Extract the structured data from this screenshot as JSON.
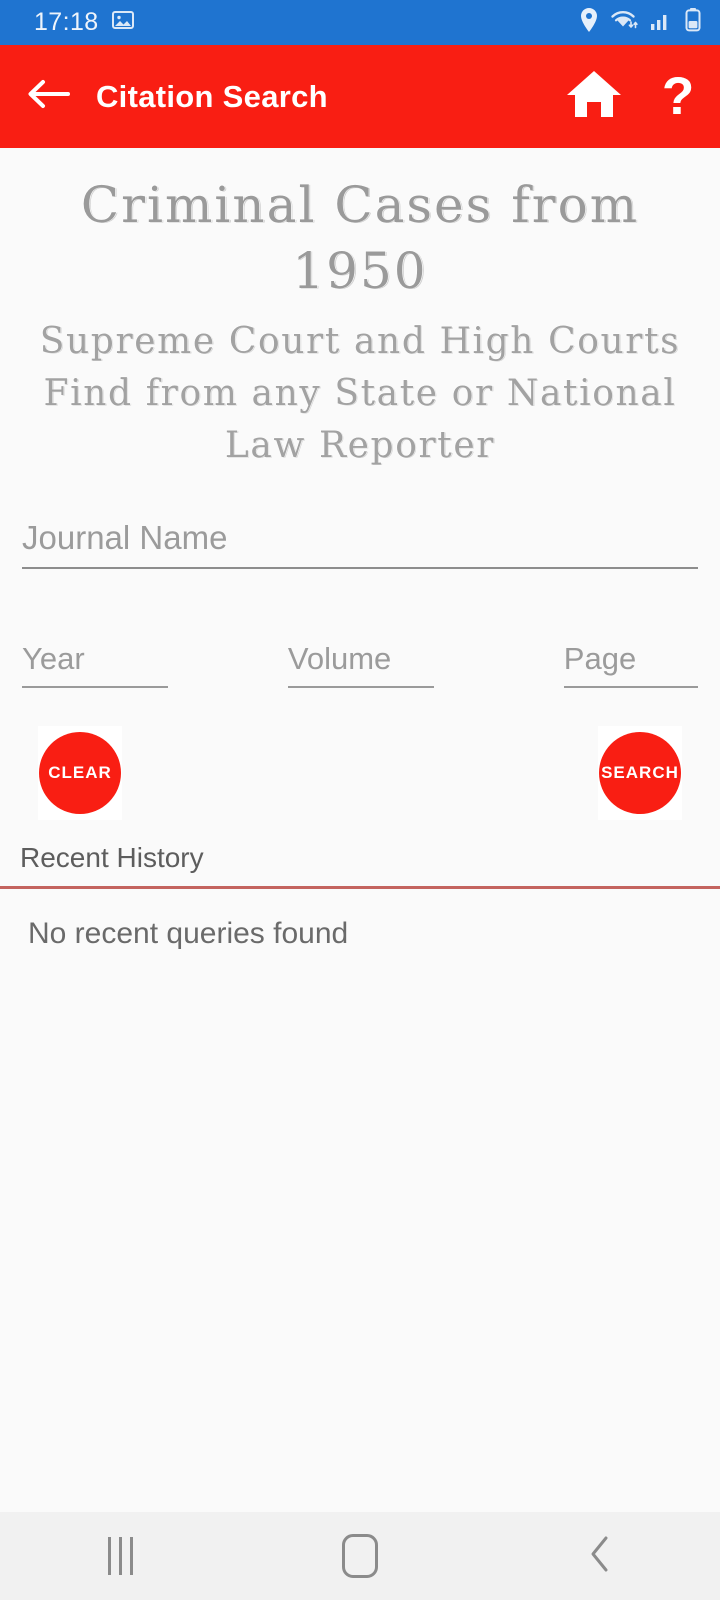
{
  "status_bar": {
    "time": "17:18",
    "icons": [
      "image-icon",
      "location-icon",
      "wifi-icon",
      "cellular-signal-icon",
      "battery-icon"
    ],
    "background_color": "#1f74d0",
    "text_color": "#eef4fb"
  },
  "app_bar": {
    "back_label": "back-arrow",
    "title": "Citation Search",
    "home_label": "home-icon",
    "help_label": "?",
    "background_color": "#f91e13",
    "text_color": "#ffffff"
  },
  "headline": {
    "line1": "Criminal Cases from",
    "line2": "1950",
    "sub1": "Supreme Court and High Courts",
    "sub2": "Find from any State or National",
    "sub3": "Law Reporter",
    "color": "#9a9a9a"
  },
  "form": {
    "journal": {
      "label": "Journal Name",
      "placeholder": "Journal Name",
      "value": ""
    },
    "year": {
      "label": "Year",
      "placeholder": "Year",
      "value": ""
    },
    "volume": {
      "label": "Volume",
      "placeholder": "Volume",
      "value": ""
    },
    "page": {
      "label": "Page",
      "placeholder": "Page",
      "value": ""
    }
  },
  "buttons": {
    "clear": "CLEAR",
    "search": "SEARCH",
    "accent_color": "#f91e13"
  },
  "history": {
    "title": "Recent History",
    "empty_message": "No recent queries found",
    "divider_color": "#c4645f"
  },
  "nav_bar": {
    "recents": "recents-icon",
    "home": "home-square-icon",
    "back": "back-chevron-icon",
    "background_color": "#f1f1f1"
  }
}
